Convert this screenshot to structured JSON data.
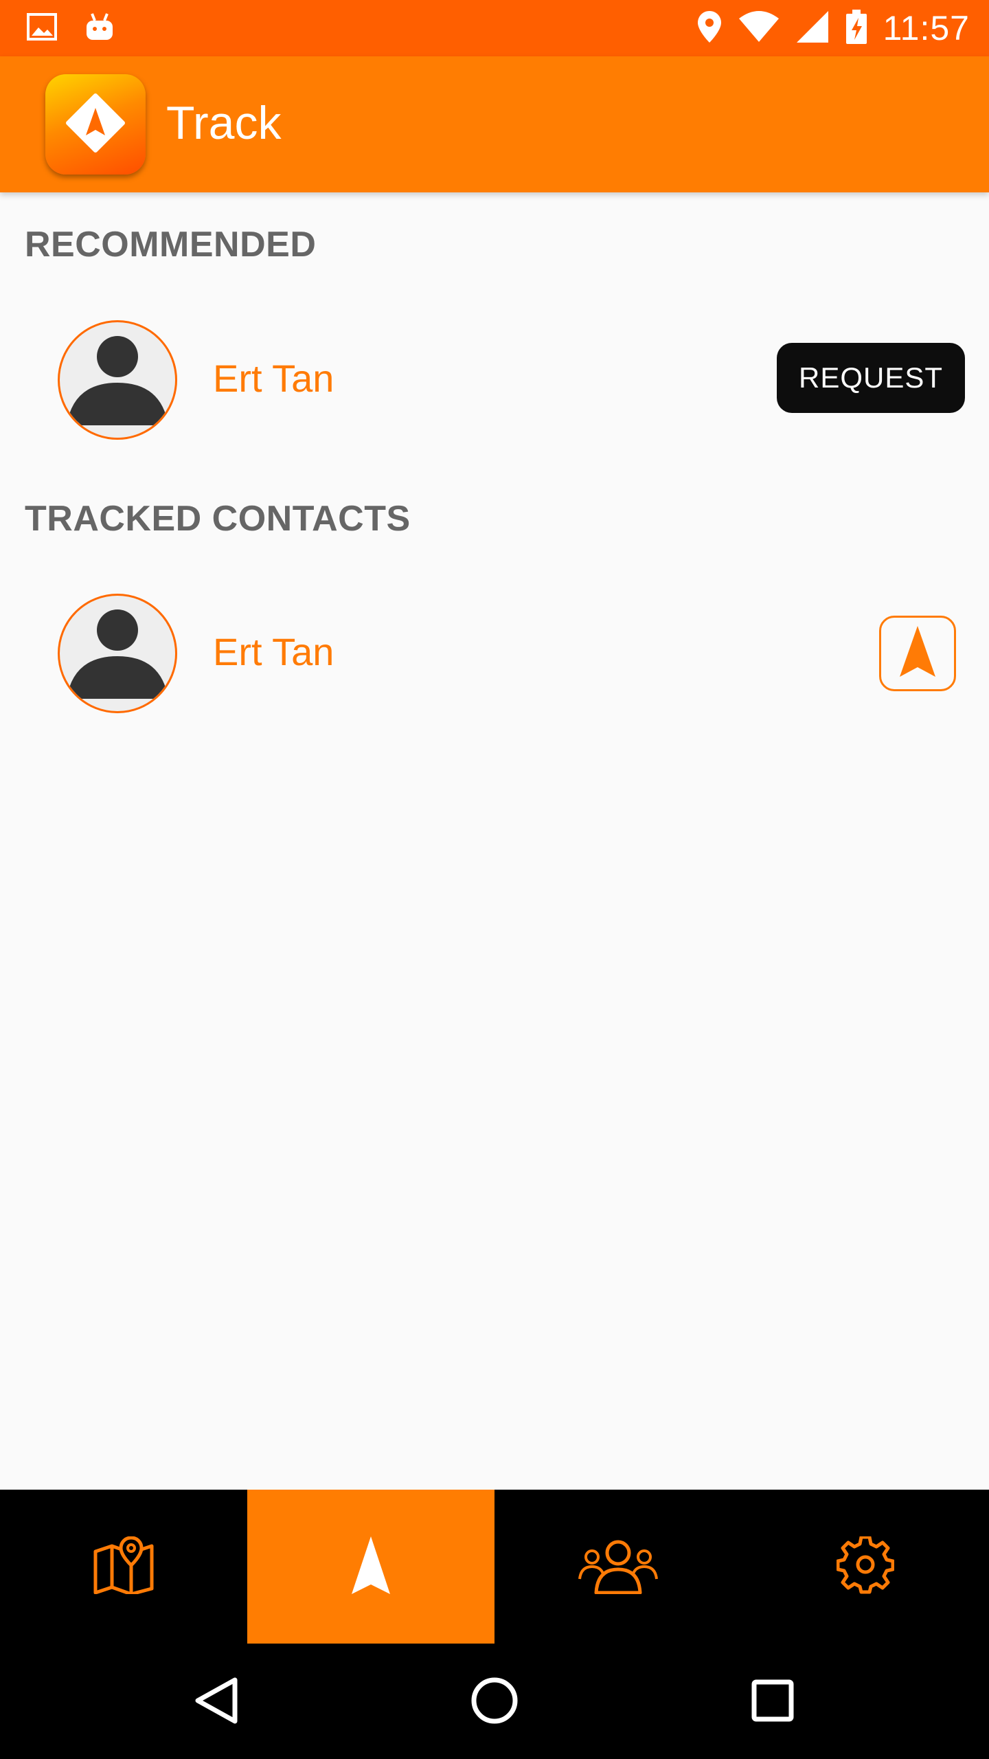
{
  "status_bar": {
    "time": "11:57",
    "left_icons": [
      "image-icon",
      "android-icon"
    ],
    "right_icons": [
      "location-icon",
      "wifi-icon",
      "signal-icon",
      "battery-charging-icon"
    ],
    "background": "#ff5f00"
  },
  "app_bar": {
    "title": "Track",
    "logo_icon": "navigation-arrow-icon",
    "background": "#ff7d02"
  },
  "sections": {
    "recommended": {
      "header": "RECOMMENDED",
      "contacts": [
        {
          "name": "Ert Tan",
          "action_label": "REQUEST"
        }
      ]
    },
    "tracked": {
      "header": "TRACKED CONTACTS",
      "contacts": [
        {
          "name": "Ert Tan",
          "action_icon": "navigation-arrow-icon"
        }
      ]
    }
  },
  "bottom_nav": {
    "items": [
      {
        "icon": "map-pin-icon",
        "active": false
      },
      {
        "icon": "navigation-arrow-icon",
        "active": true
      },
      {
        "icon": "contacts-group-icon",
        "active": false
      },
      {
        "icon": "gear-icon",
        "active": false
      }
    ],
    "accent": "#ff7d02"
  },
  "system_nav": {
    "items": [
      "back-icon",
      "home-icon",
      "recents-icon"
    ]
  },
  "colors": {
    "accent": "#ff7b06",
    "section_header": "#666666",
    "request_button_bg": "#0d0d0d"
  }
}
